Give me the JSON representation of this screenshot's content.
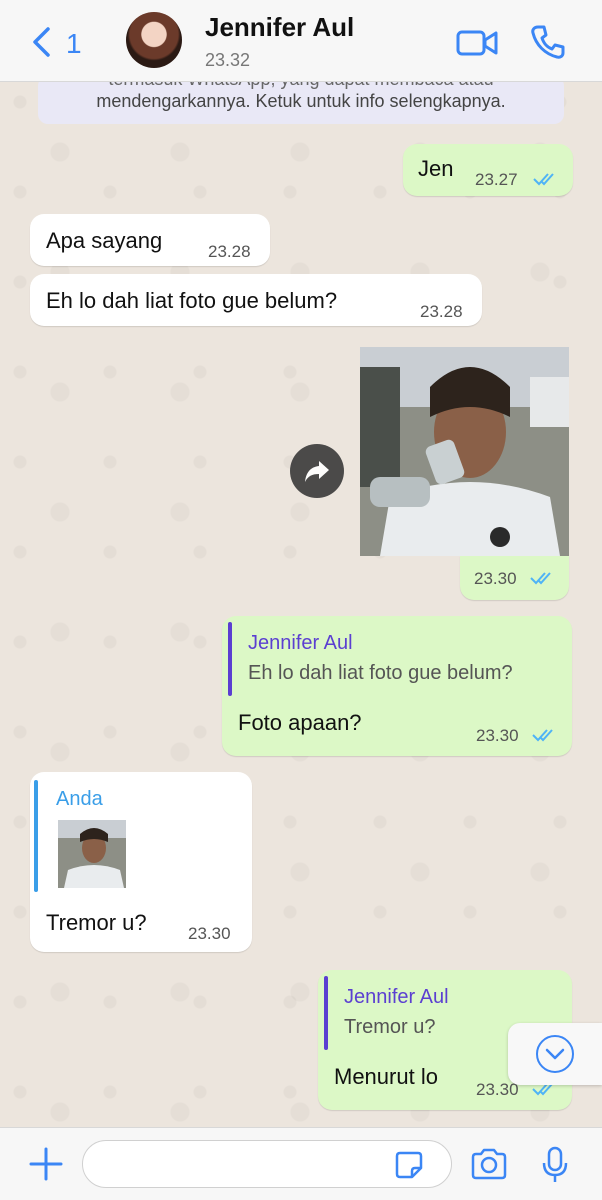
{
  "header": {
    "back_count": "1",
    "contact_name": "Jennifer Aul",
    "last_seen": "23.32",
    "icons": {
      "back": "chevron-left-icon",
      "video": "video-call-icon",
      "call": "phone-icon"
    }
  },
  "notice": {
    "line1": "termasuk WhatsApp, yang dapat membaca atau",
    "line2": "mendengarkannya. Ketuk untuk info selengkapnya."
  },
  "messages": [
    {
      "direction": "out",
      "text": "Jen",
      "time": "23.27",
      "read": true
    },
    {
      "direction": "in",
      "text": "Apa sayang",
      "time": "23.28"
    },
    {
      "direction": "in",
      "text": "Eh lo dah liat foto gue belum?",
      "time": "23.28"
    },
    {
      "direction": "out",
      "type": "photo",
      "time": "23.30",
      "read": true
    },
    {
      "direction": "out",
      "reply_author": "Jennifer Aul",
      "reply_text": "Eh lo dah liat foto gue belum?",
      "text": "Foto apaan?",
      "time": "23.30",
      "read": true
    },
    {
      "direction": "in",
      "reply_author": "Anda",
      "reply_type": "photo",
      "text": "Tremor u?",
      "time": "23.30"
    },
    {
      "direction": "out",
      "reply_author": "Jennifer Aul",
      "reply_text": "Tremor u?",
      "text": "Menurut lo",
      "time": "23.30",
      "read": true
    }
  ],
  "colors": {
    "accent": "#3b86f5",
    "outgoing_bubble": "#dcf8c6",
    "incoming_bubble": "#ffffff",
    "chat_background": "#ece5dd",
    "quote_bar_self": "#5b3fd1",
    "quote_bar_other": "#3a9ee8",
    "read_ticks": "#4fb3f6"
  },
  "composer": {
    "placeholder": "",
    "icons": [
      "plus-icon",
      "sticker-icon",
      "camera-icon",
      "microphone-icon"
    ]
  }
}
